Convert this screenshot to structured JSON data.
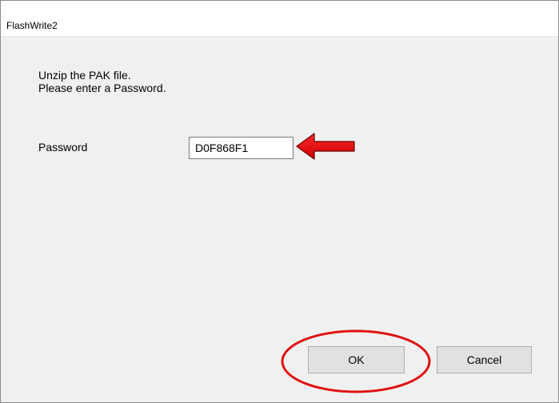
{
  "window": {
    "title": "FlashWrite2"
  },
  "message": {
    "line1": "Unzip the PAK file.",
    "line2": "Please enter a Password."
  },
  "password": {
    "label": "Password",
    "value": "D0F868F1"
  },
  "buttons": {
    "ok_label": "OK",
    "cancel_label": "Cancel"
  },
  "annotations": {
    "arrow_color": "#e00000",
    "circle_color": "#e01010"
  }
}
